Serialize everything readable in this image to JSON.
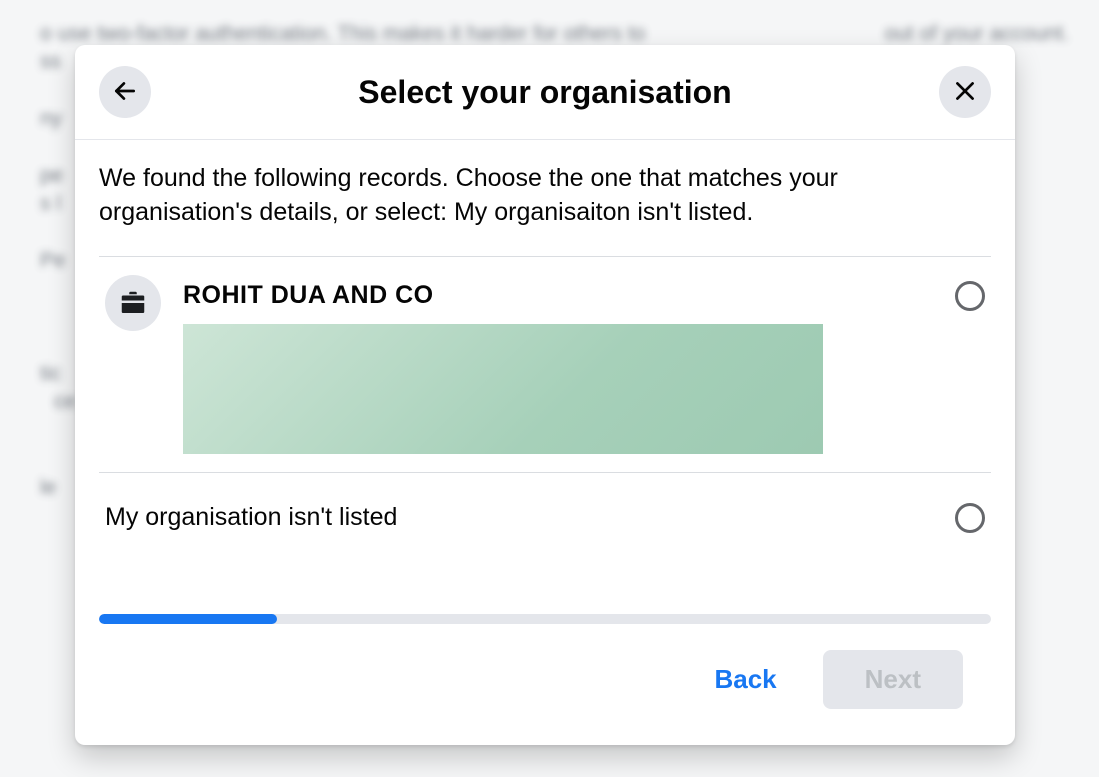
{
  "background": {
    "line1": "o use two-factor authentication. This makes it harder for others to",
    "line1b": "out of your account.",
    "frag1": "ss",
    "frag2": "ny",
    "frag3": "pe",
    "frag4": "s l",
    "frag5": "Pe",
    "frag6": "tic",
    "frag7": "ce",
    "frag8": "le"
  },
  "modal": {
    "title": "Select your organisation",
    "intro": "We found the following records. Choose the one that matches your organisation's details, or select: My organisaiton isn't listed.",
    "options": [
      {
        "name": "ROHIT DUA AND CO",
        "selected": false,
        "hasIcon": true,
        "redacted": true
      },
      {
        "name": "My organisation isn't listed",
        "selected": false,
        "hasIcon": false,
        "redacted": false
      }
    ],
    "progress_percent": 20,
    "buttons": {
      "back": "Back",
      "next": "Next",
      "next_disabled": true
    },
    "icons": {
      "back": "arrow-left-icon",
      "close": "close-icon",
      "org": "briefcase-icon"
    },
    "colors": {
      "accent": "#1877f2",
      "neutral_bg": "#e4e6eb",
      "text": "#050505",
      "disabled_text": "#bcc0c4"
    }
  }
}
